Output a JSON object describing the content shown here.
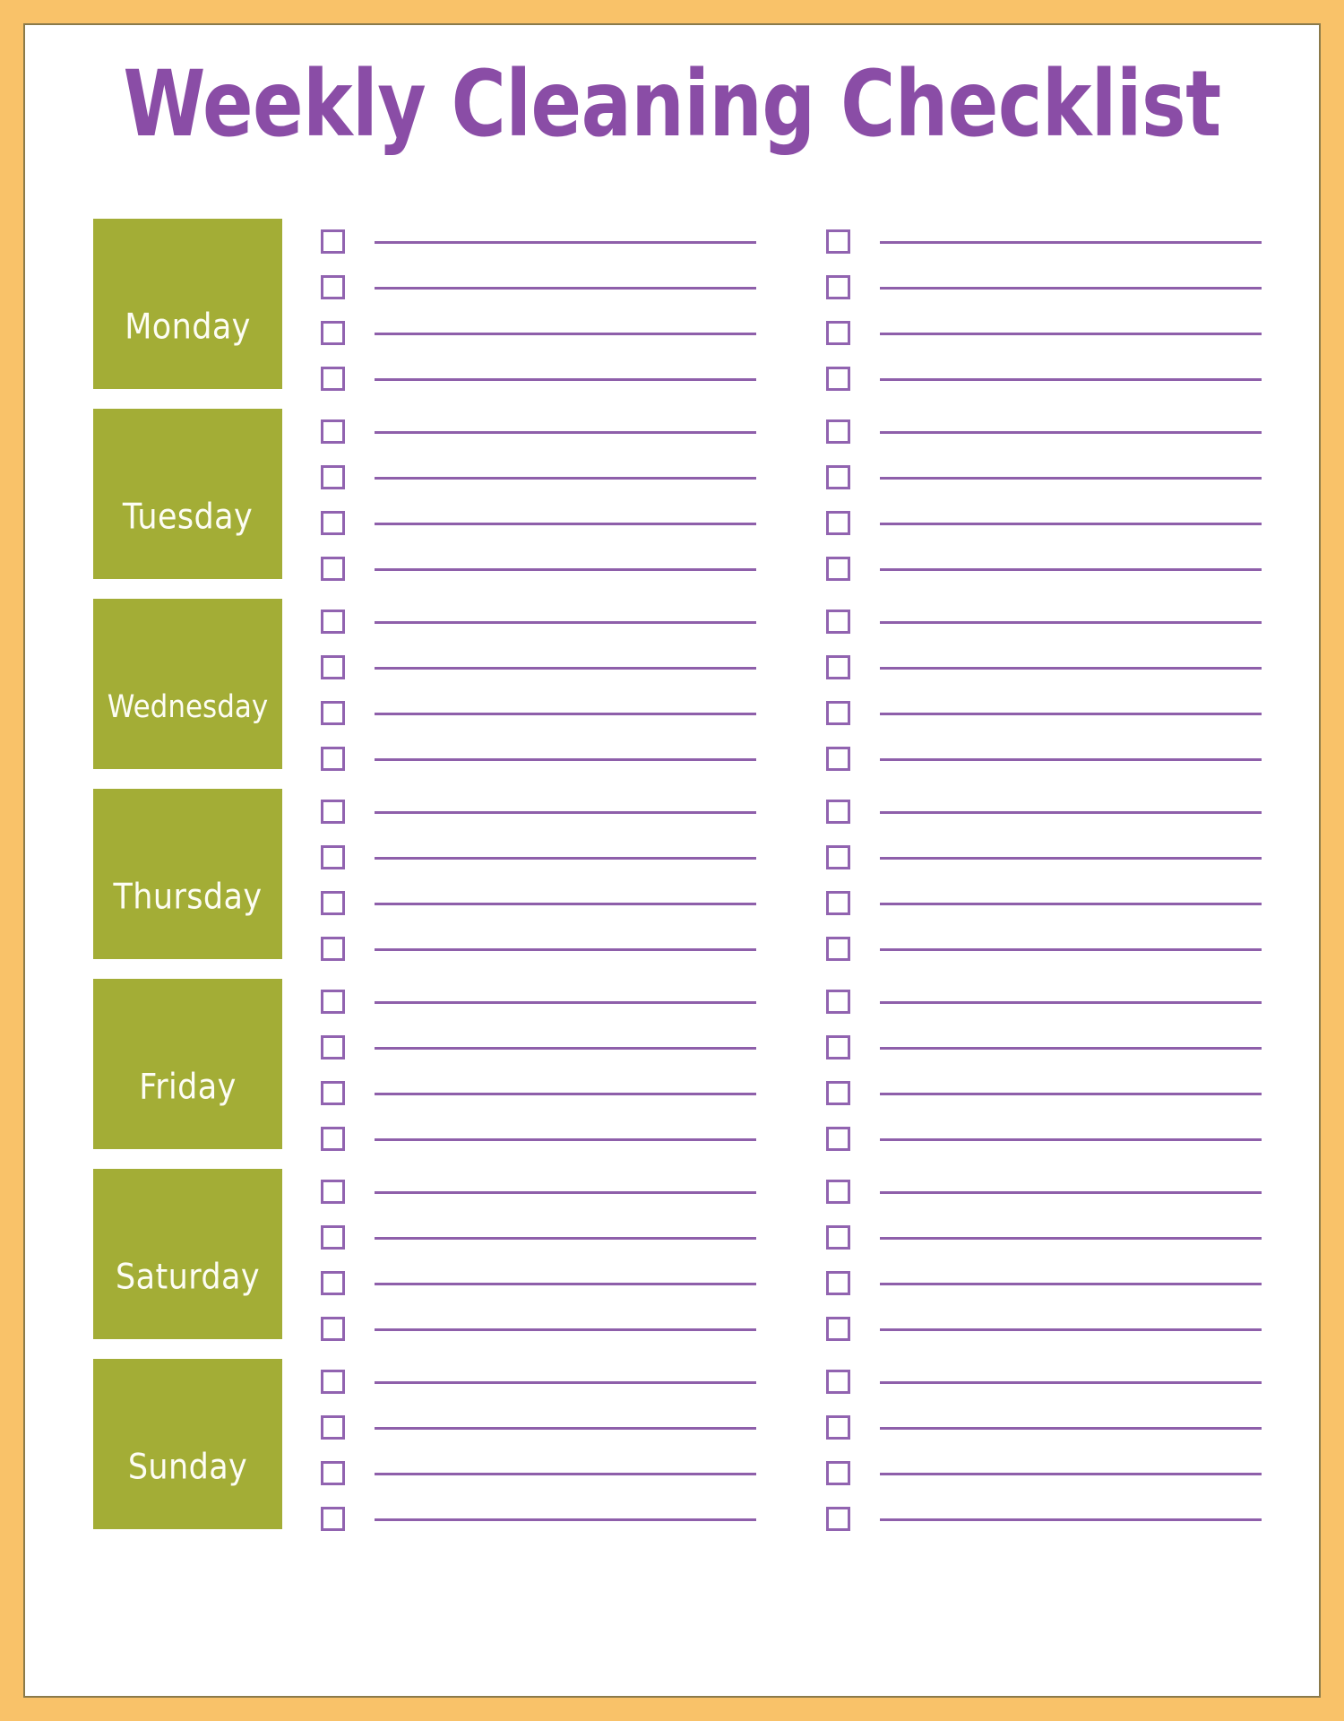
{
  "page": {
    "title": "Weekly Cleaning Checklist",
    "border_color": "#f9c269",
    "accent_purple": "#8a4da6",
    "line_purple": "#8e5faa",
    "day_block_green": "#a3ad36",
    "day_label_color": "#fdfdf4",
    "background": "#ffffff"
  },
  "checklist": {
    "columns_per_day": 2,
    "rows_per_column": 4,
    "checkbox_state": "unchecked",
    "line_value": "",
    "line_placeholder": ""
  },
  "days": [
    {
      "label": "Monday",
      "items_col_a": [
        "",
        "",
        "",
        ""
      ],
      "items_col_b": [
        "",
        "",
        "",
        ""
      ]
    },
    {
      "label": "Tuesday",
      "items_col_a": [
        "",
        "",
        "",
        ""
      ],
      "items_col_b": [
        "",
        "",
        "",
        ""
      ]
    },
    {
      "label": "Wednesday",
      "items_col_a": [
        "",
        "",
        "",
        ""
      ],
      "items_col_b": [
        "",
        "",
        "",
        ""
      ]
    },
    {
      "label": "Thursday",
      "items_col_a": [
        "",
        "",
        "",
        ""
      ],
      "items_col_b": [
        "",
        "",
        "",
        ""
      ]
    },
    {
      "label": "Friday",
      "items_col_a": [
        "",
        "",
        "",
        ""
      ],
      "items_col_b": [
        "",
        "",
        "",
        ""
      ]
    },
    {
      "label": "Saturday",
      "items_col_a": [
        "",
        "",
        "",
        ""
      ],
      "items_col_b": [
        "",
        "",
        "",
        ""
      ]
    },
    {
      "label": "Sunday",
      "items_col_a": [
        "",
        "",
        "",
        ""
      ],
      "items_col_b": [
        "",
        "",
        "",
        ""
      ]
    }
  ]
}
